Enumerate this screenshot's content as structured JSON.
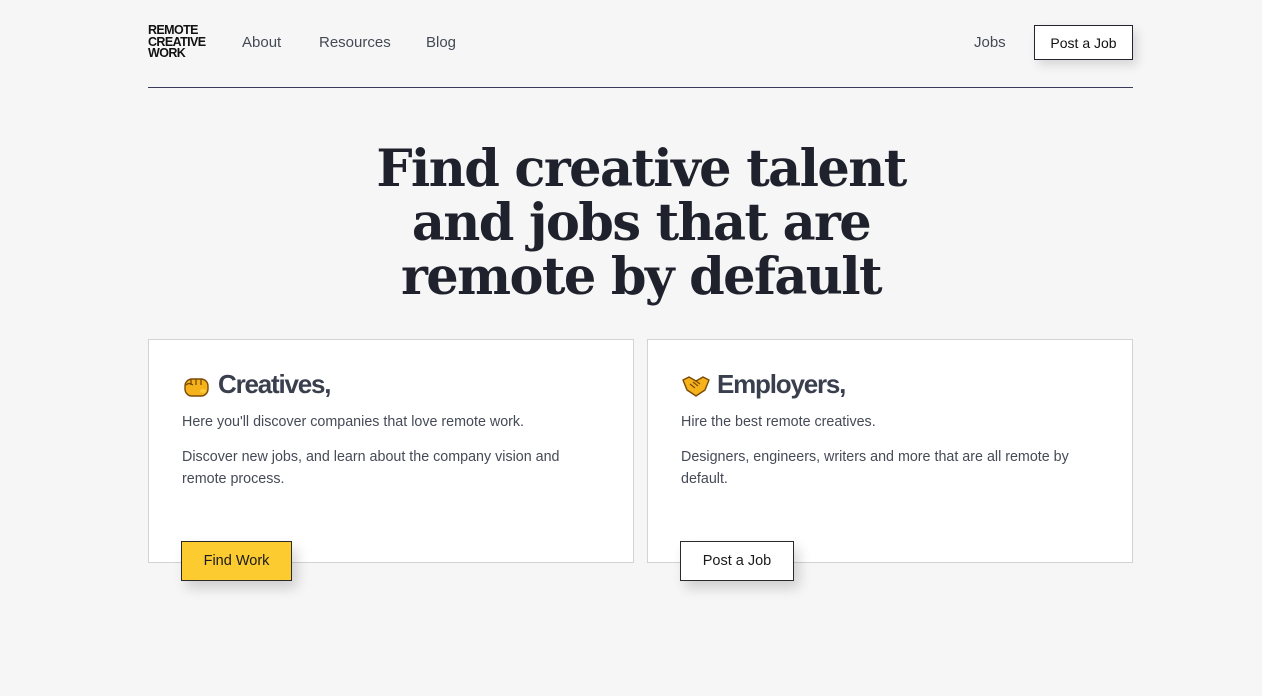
{
  "header": {
    "logo_lines": [
      "REMOTE",
      "CREATIVE",
      "WORK"
    ],
    "nav": [
      "About",
      "Resources",
      "Blog"
    ],
    "jobs_link": "Jobs",
    "post_job_button": "Post a Job"
  },
  "hero": {
    "headline": "Find creative talent and jobs that are remote by default"
  },
  "cards": [
    {
      "icon": "fist-emoji-icon",
      "title": "Creatives,",
      "line1": "Here you'll discover companies that love remote work.",
      "line2": "Discover new jobs, and learn about the company vision and remote process.",
      "button": "Find Work"
    },
    {
      "icon": "handshake-emoji-icon",
      "title": "Employers,",
      "line1": "Hire the best remote creatives.",
      "line2": "Designers, engineers, writers and more that are all remote by default.",
      "button": "Post a Job"
    }
  ],
  "colors": {
    "background": "#f6f6f6",
    "accent_yellow": "#fbcb2f",
    "text_dark": "#1f222c"
  }
}
